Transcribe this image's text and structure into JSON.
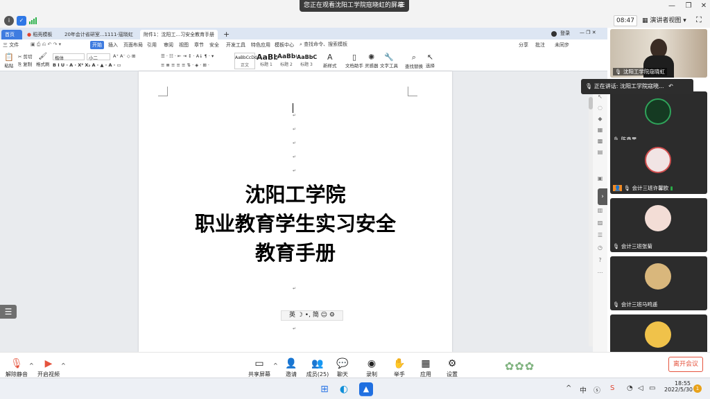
{
  "meeting": {
    "share_banner": "您正在观看沈阳工学院寇晓虹的屏幕",
    "time": "08:47",
    "view_mode": "演讲者视图",
    "leave_label": "离开会议"
  },
  "wps": {
    "tabs": [
      {
        "label": "首页"
      },
      {
        "label": "稻壳模板"
      },
      {
        "label": "20年会计省研室...1111-寇晓虹"
      },
      {
        "label": "附件1：沈阳工...习安全教育手册"
      }
    ],
    "user_label": "登录",
    "menu": [
      "三 文件",
      "开始",
      "插入",
      "页面布局",
      "引用",
      "审阅",
      "视图",
      "章节",
      "安全",
      "开发工具",
      "特色应用",
      "模板中心"
    ],
    "search_placeholder": "查找命令、搜索模板",
    "right_menu": [
      "分享",
      "批注",
      "未同步"
    ],
    "ribbon": {
      "paste": "粘贴",
      "cut": "剪切",
      "copy": "复制",
      "format_painter": "格式刷",
      "font_name": "楷体",
      "font_size": "小二",
      "styles": [
        {
          "sample": "AaBbCcDd",
          "name": "正文"
        },
        {
          "sample": "AaBb",
          "name": "标题 1"
        },
        {
          "sample": "AaBb(",
          "name": "标题 2"
        },
        {
          "sample": "AaBbC",
          "name": "标题 3"
        }
      ],
      "new_style": "新样式",
      "doc_assistant": "文档助手",
      "ai_polish": "灵感器",
      "text_tools": "文字工具",
      "find_replace": "查找替换",
      "select": "选择"
    }
  },
  "document": {
    "title_lines": [
      "沈阳工学院",
      "职业教育学生实习安全",
      "教育手册"
    ],
    "ime_bar": "英 ☽ •, 简 ☺ ⚙"
  },
  "participants": [
    {
      "name": "沈阳工学院寇晓虹"
    },
    {
      "name": "陈鑫男"
    },
    {
      "name": "会计三班许馨欧"
    },
    {
      "name": "会计三班张菊"
    },
    {
      "name": "会计三班马鸣遥"
    }
  ],
  "speaking_label": "正在讲话: 沈阳工学院寇晓...",
  "toolbar": {
    "unmute": "解除静音",
    "start_video": "开启视频",
    "share_screen": "共享屏幕",
    "invite": "邀请",
    "members": "成员(25)",
    "chat": "聊天",
    "record": "录制",
    "raise_hand": "举手",
    "apps": "应用",
    "settings": "设置"
  },
  "taskbar": {
    "lang": "中",
    "time": "18:55",
    "date": "2022/5/30",
    "notification_count": "1"
  },
  "colors": {
    "wps_accent": "#3f7ce0",
    "leave_red": "#e5533d"
  }
}
